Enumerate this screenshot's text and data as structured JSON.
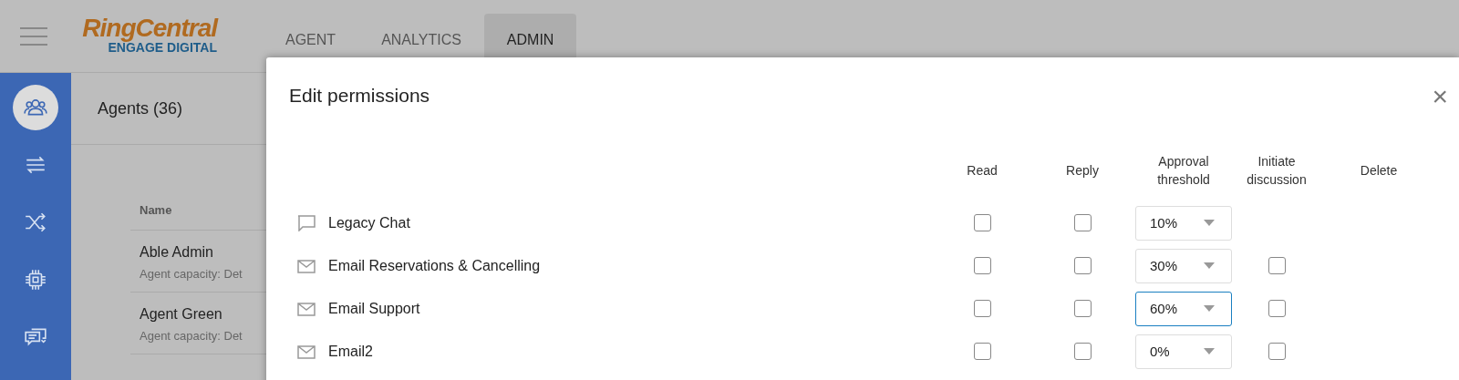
{
  "header": {
    "logo": {
      "brand": "RingCentral",
      "product": "ENGAGE DIGITAL"
    },
    "tabs": [
      {
        "label": "AGENT",
        "selected": false
      },
      {
        "label": "ANALYTICS",
        "selected": false
      },
      {
        "label": "ADMIN",
        "selected": true
      }
    ]
  },
  "sidebar": {
    "items": [
      {
        "kind": "people",
        "selected": true
      },
      {
        "kind": "transfer",
        "selected": false
      },
      {
        "kind": "shuffle",
        "selected": false
      },
      {
        "kind": "chip",
        "selected": false
      },
      {
        "kind": "messages",
        "selected": false
      }
    ]
  },
  "agents": {
    "title": "Agents (36)",
    "column": "Name",
    "rows": [
      {
        "name": "Able Admin",
        "detail": "Agent capacity: Det"
      },
      {
        "name": "Agent Green",
        "detail": "Agent capacity: Det"
      }
    ]
  },
  "dialog": {
    "title": "Edit permissions",
    "close": "×",
    "columns": [
      "Read",
      "Reply",
      "Approval threshold",
      "Initiate discussion",
      "Delete"
    ],
    "rows": [
      {
        "kind": "chat",
        "name": "Legacy Chat",
        "read": false,
        "reply": false,
        "threshold": "10%",
        "focused": false
      },
      {
        "kind": "email",
        "name": "Email Reservations & Cancelling",
        "read": false,
        "reply": false,
        "threshold": "30%",
        "focused": false,
        "initiate": false
      },
      {
        "kind": "email",
        "name": "Email Support",
        "read": false,
        "reply": false,
        "threshold": "60%",
        "focused": true,
        "initiate": false
      },
      {
        "kind": "email",
        "name": "Email2",
        "read": false,
        "reply": false,
        "threshold": "0%",
        "focused": false,
        "initiate": false
      }
    ]
  }
}
